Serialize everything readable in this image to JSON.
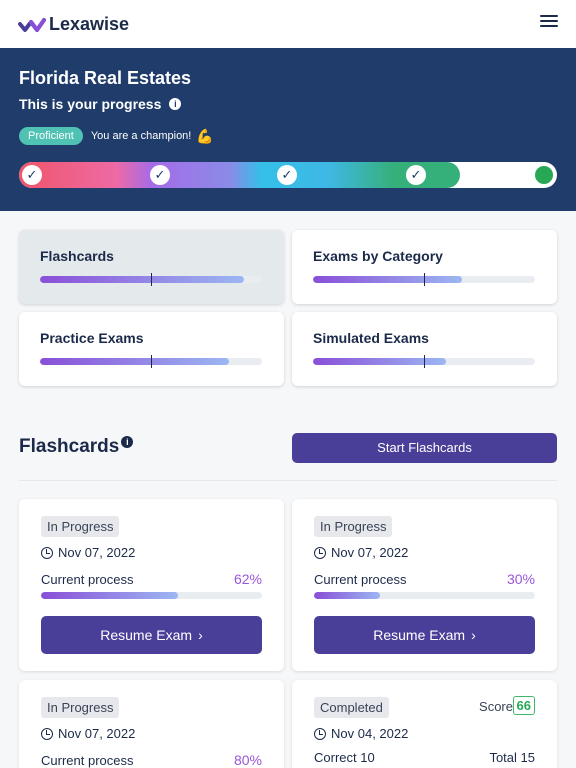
{
  "app": {
    "name": "Lexawise"
  },
  "hero": {
    "title": "Florida Real Estates",
    "subtitle": "This is your progress",
    "badge": "Proficient",
    "message": "You are a champion!",
    "emoji": "💪",
    "progress_steps_completed": 4,
    "progress_steps_total": 5,
    "colors": {
      "background": "#1f3c6b",
      "badge": "#4fc2b4",
      "final_step": "#28a855"
    }
  },
  "categories": [
    {
      "label": "Flashcards",
      "progress": 0.92,
      "active": true
    },
    {
      "label": "Exams by Category",
      "progress": 0.67,
      "active": false
    },
    {
      "label": "Practice Exams",
      "progress": 0.85,
      "active": false
    },
    {
      "label": "Simulated Exams",
      "progress": 0.6,
      "active": false
    }
  ],
  "section": {
    "title": "Flashcards",
    "start_button": "Start Flashcards"
  },
  "cards": [
    {
      "status": "In Progress",
      "date": "Nov 07, 2022",
      "process_label": "Current process",
      "percent_label": "62%",
      "percent": 0.62,
      "button": "Resume Exam"
    },
    {
      "status": "In Progress",
      "date": "Nov 07, 2022",
      "process_label": "Current process",
      "percent_label": "30%",
      "percent": 0.3,
      "button": "Resume Exam"
    },
    {
      "status": "In Progress",
      "date": "Nov 07, 2022",
      "process_label": "Current process",
      "percent_label": "80%",
      "percent": 0.8
    },
    {
      "status": "Completed",
      "date": "Nov 04, 2022",
      "score_label": "Score",
      "score": "66",
      "correct": "Correct 10",
      "total": "Total 15"
    }
  ],
  "accent_color": "#4a3f98",
  "percent_color": "#9a55d8"
}
